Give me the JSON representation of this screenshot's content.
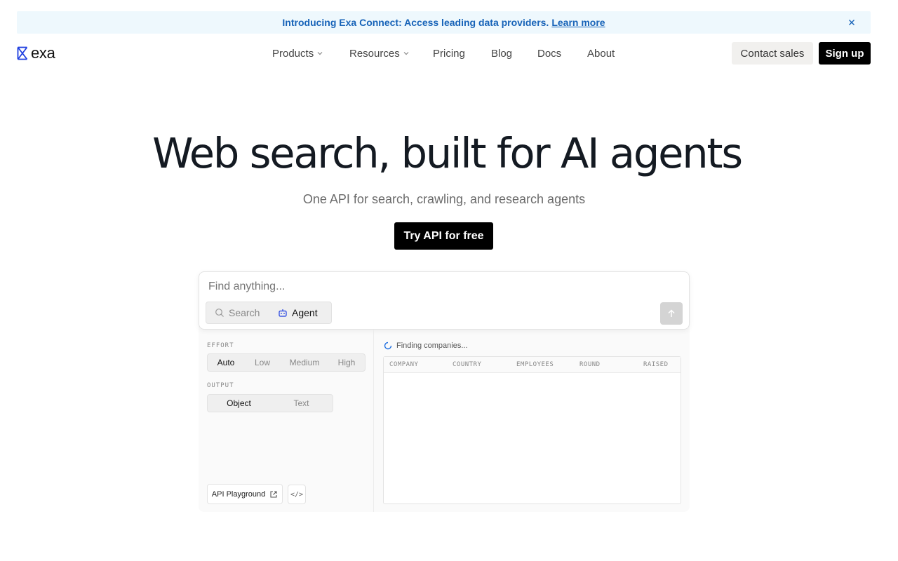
{
  "banner": {
    "text": "Introducing Exa Connect: Access leading data providers.",
    "link": "Learn more"
  },
  "brand": {
    "name": "exa",
    "accent": "#1f3fe0"
  },
  "nav": {
    "items": [
      {
        "label": "Products",
        "dropdown": true
      },
      {
        "label": "Resources",
        "dropdown": true
      },
      {
        "label": "Pricing",
        "dropdown": false
      },
      {
        "label": "Blog",
        "dropdown": false
      },
      {
        "label": "Docs",
        "dropdown": false
      },
      {
        "label": "About",
        "dropdown": false
      }
    ],
    "contact": "Contact sales",
    "signup": "Sign up"
  },
  "hero": {
    "title": "Web search, built for AI agents",
    "subtitle": "One API for search, crawling, and research agents",
    "cta": "Try API for free"
  },
  "demo": {
    "search_placeholder": "Find anything...",
    "modes": [
      "Search",
      "Agent"
    ],
    "active_mode": "Agent",
    "effort_label": "EFFORT",
    "effort_options": [
      "Auto",
      "Low",
      "Medium",
      "High"
    ],
    "effort_selected": "Auto",
    "output_label": "OUTPUT",
    "output_options": [
      "Object",
      "Text"
    ],
    "output_selected": "Object",
    "playground": "API Playground",
    "code_icon": "</>",
    "status": "Finding companies...",
    "columns": [
      "COMPANY",
      "COUNTRY",
      "EMPLOYEES",
      "ROUND",
      "RAISED"
    ]
  }
}
